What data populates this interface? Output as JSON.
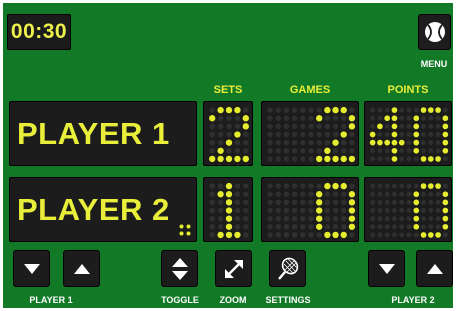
{
  "timer": "00:30",
  "menu": {
    "label": "MENU",
    "icon": "tennis-ball-icon"
  },
  "headers": {
    "sets": "SETS",
    "games": "GAMES",
    "points": "POINTS"
  },
  "players": [
    {
      "name": "PLAYER 1",
      "sets": "2",
      "games": "2",
      "points": "40",
      "serving": false
    },
    {
      "name": "PLAYER 2",
      "sets": "1",
      "games": "0",
      "points": "0",
      "serving": true
    }
  ],
  "controls": {
    "player1_label": "PLAYER 1",
    "toggle_label": "TOGGLE",
    "zoom_label": "ZOOM",
    "settings_label": "SETTINGS",
    "player2_label": "PLAYER 2"
  },
  "colors": {
    "background": "#127a27",
    "panel": "#1c1c1c",
    "digit_on": "#e6ed2f",
    "digit_off": "#2f2f2f"
  }
}
